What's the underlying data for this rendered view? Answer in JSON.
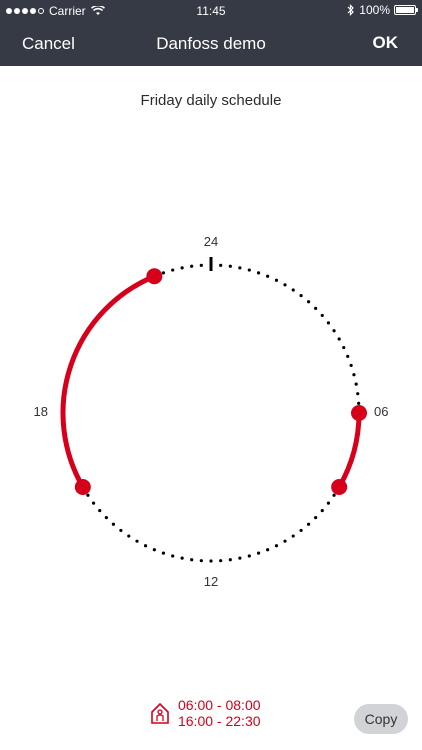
{
  "status": {
    "carrier": "Carrier",
    "time": "11:45",
    "battery": "100%"
  },
  "nav": {
    "cancel_label": "Cancel",
    "title": "Danfoss demo",
    "ok_label": "OK"
  },
  "schedule": {
    "title": "Friday daily schedule",
    "hour_labels": {
      "top": "24",
      "right": "06",
      "bottom": "12",
      "left": "18"
    },
    "periods": [
      "06:00 - 08:00",
      "16:00 - 22:30"
    ],
    "copy_label": "Copy"
  },
  "colors": {
    "header_bg": "#353a45",
    "accent_red": "#d7001b",
    "copy_button_bg": "#d1d3d6"
  },
  "icons": {
    "home": "home-person-icon",
    "wifi": "wifi-icon",
    "bluetooth": "bluetooth-icon",
    "battery": "battery-icon"
  }
}
